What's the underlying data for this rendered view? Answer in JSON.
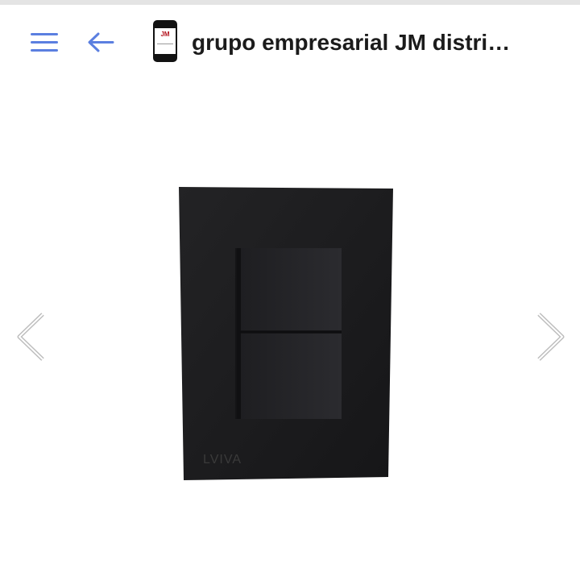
{
  "header": {
    "menu_icon": "hamburger-menu-icon",
    "back_icon": "arrow-left-icon",
    "store_title": "grupo empresarial JM distri…",
    "logo": {
      "text": "JM",
      "colors": {
        "background": "#121212",
        "letters": "#b4141e"
      }
    }
  },
  "gallery": {
    "prev_icon": "chevron-left-icon",
    "next_icon": "chevron-right-icon",
    "product_image": {
      "subject": "black wall plate with two rocker switches",
      "brand_text": "LVIVA"
    }
  },
  "colors": {
    "accent": "#5b7fe0",
    "title_text": "#1b1b1b",
    "product_plate": "#1a1a1c"
  }
}
